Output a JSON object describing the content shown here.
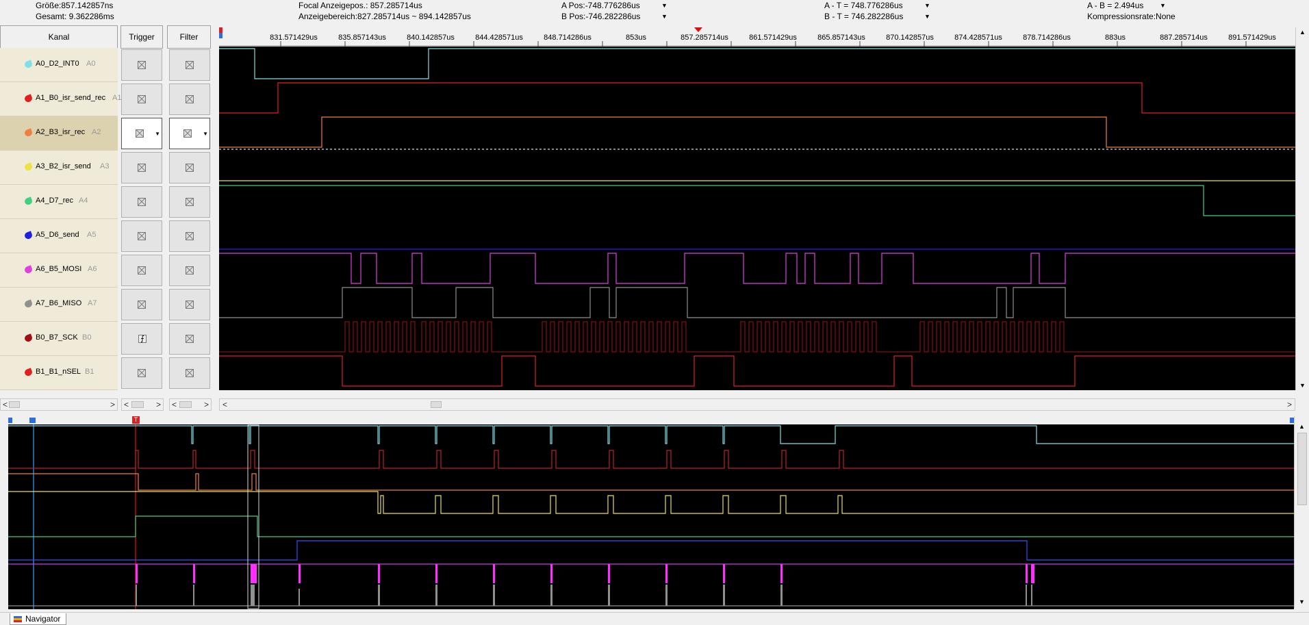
{
  "info": {
    "groesse": "Größe:857.142857ns",
    "gesamt": "Gesamt: 9.362286ms",
    "focal": "Focal Anzeigepos.: 857.285714us",
    "bereich": "Anzeigebereich:827.285714us ~ 894.142857us",
    "a_pos": "A Pos:-748.776286us",
    "b_pos": "B Pos:-746.282286us",
    "a_t": "A - T = 748.776286us",
    "b_t": "B - T = 746.282286us",
    "a_b": "A - B = 2.494us",
    "kompression": "Kompressionsrate:None",
    "dropdown_glyph": "▼"
  },
  "headers": {
    "kanal": "Kanal",
    "trigger": "Trigger",
    "filter": "Filter"
  },
  "channels": [
    {
      "name": "A0_D2_INT0",
      "tag": "A0",
      "color": "#7ee0e8"
    },
    {
      "name": "A1_B0_isr_send_rec",
      "tag": "A1",
      "color": "#e02020"
    },
    {
      "name": "A2_B3_isr_rec",
      "tag": "A2",
      "color": "#f08040"
    },
    {
      "name": "A3_B2_isr_send",
      "tag": "A3",
      "color": "#f0e040"
    },
    {
      "name": "A4_D7_rec",
      "tag": "A4",
      "color": "#40d080"
    },
    {
      "name": "A5_D6_send",
      "tag": "A5",
      "color": "#2020e0"
    },
    {
      "name": "A6_B5_MOSI",
      "tag": "A6",
      "color": "#e040e0"
    },
    {
      "name": "A7_B6_MISO",
      "tag": "A7",
      "color": "#909090"
    },
    {
      "name": "B0_B7_SCK",
      "tag": "B0",
      "color": "#a01010"
    },
    {
      "name": "B1_B1_nSEL",
      "tag": "B1",
      "color": "#e02020"
    }
  ],
  "ruler_ticks": [
    "831.571429us",
    "835.857143us",
    "840.142857us",
    "844.428571us",
    "848.714286us",
    "853us",
    "857.285714us",
    "861.571429us",
    "865.857143us",
    "870.142857us",
    "874.428571us",
    "878.714286us",
    "883us",
    "887.285714us",
    "891.571429us"
  ],
  "scroll": {
    "left": "<",
    "right": ">",
    "up": "▲",
    "down": "▼"
  },
  "navigator": {
    "tab_label": "Navigator",
    "trigger_marker": "T"
  }
}
